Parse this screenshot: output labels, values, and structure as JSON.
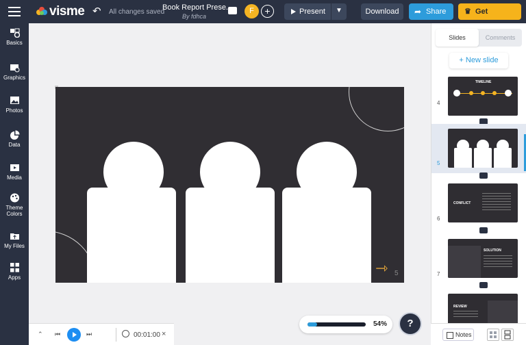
{
  "topbar": {
    "logo_text": "visme",
    "saved_status": "All changes saved",
    "title": "Book Report Prese...",
    "byline": "By fdhca",
    "avatar_initial": "F",
    "present_label": "Present",
    "download_label": "Download",
    "share_label": "Share",
    "premium_label": "Get Premium"
  },
  "sidebar": {
    "items": [
      {
        "label": "Basics",
        "icon": "shapes-icon"
      },
      {
        "label": "Graphics",
        "icon": "graphics-icon"
      },
      {
        "label": "Photos",
        "icon": "image-icon"
      },
      {
        "label": "Data",
        "icon": "pie-chart-icon"
      },
      {
        "label": "Media",
        "icon": "video-icon"
      },
      {
        "label": "Theme\nColors",
        "icon": "palette-icon"
      },
      {
        "label": "My Files",
        "icon": "folder-upload-icon"
      },
      {
        "label": "Apps",
        "icon": "apps-grid-icon"
      }
    ]
  },
  "canvas": {
    "page_number": "5"
  },
  "player": {
    "time": "00:01:00"
  },
  "zoom": {
    "value_label": "54%",
    "level": 0.54
  },
  "help_label": "?",
  "right_panel": {
    "tabs": [
      "Slides",
      "Comments"
    ],
    "new_slide_label": "+ New slide",
    "thumbnails": [
      {
        "number": "4",
        "title": "TIMELINE"
      },
      {
        "number": "5",
        "title": ""
      },
      {
        "number": "6",
        "title": "CONFLICT"
      },
      {
        "number": "7",
        "title": "SOLUTION"
      },
      {
        "number": "",
        "title": "REVIEW"
      }
    ],
    "notes_label": "Notes"
  },
  "colors": {
    "accent": "#2d9cdb",
    "premium": "#f6b31b",
    "dark": "#2a3142"
  }
}
